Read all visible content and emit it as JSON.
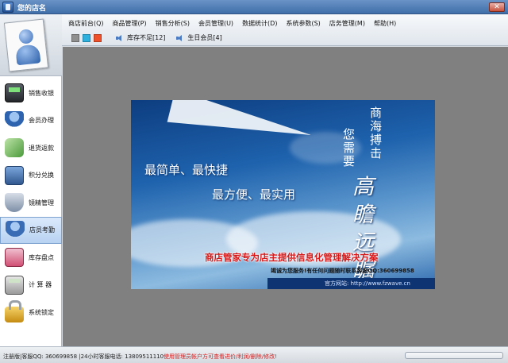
{
  "window": {
    "title": "您的店名",
    "close_glyph": "✕"
  },
  "menu": [
    "商店前台(Q)",
    "商品管理(P)",
    "销售分析(S)",
    "会员管理(U)",
    "数据统计(D)",
    "系统参数(S)",
    "店务管理(M)",
    "帮助(H)"
  ],
  "toolbar": {
    "swatches": [
      "#8f8f8f",
      "#2eb0de",
      "#f0502a"
    ],
    "stock_alert": "库存不足[12]",
    "birthday_alert": "生日会员[4]"
  },
  "sidebar": {
    "items": [
      {
        "label": "销售收银",
        "icon": "pos-terminal-icon"
      },
      {
        "label": "会员办理",
        "icon": "member-icon"
      },
      {
        "label": "退货返款",
        "icon": "return-icon"
      },
      {
        "label": "积分兑换",
        "icon": "points-exchange-icon"
      },
      {
        "label": "镜精管理",
        "icon": "shield-icon"
      },
      {
        "label": "店员考勤",
        "icon": "staff-icon",
        "active": true
      },
      {
        "label": "库存盘点",
        "icon": "inventory-icon"
      },
      {
        "label": "计 算 器",
        "icon": "calculator-icon"
      },
      {
        "label": "系统锁定",
        "icon": "lock-icon"
      }
    ]
  },
  "banner": {
    "slogan1": "最简单、最快捷",
    "slogan2": "最方便、最实用",
    "vertical1": "商海搏击",
    "vertical2": "您需要",
    "calligraphy": "高瞻远瞩",
    "tagline": "商店管家专为店主提供信息化管理解决方案",
    "contact": "竭诚为您服务!有任何问题随时联系客服QQ:360699858",
    "site": "官方网站: http://www.fzwave.cn"
  },
  "status": {
    "info": "注册版|客服QQ: 360699858 |24小时客服电话: 13809511110",
    "warning": "使用管理员帐户方可查看进价/利润/删除/修改!"
  }
}
